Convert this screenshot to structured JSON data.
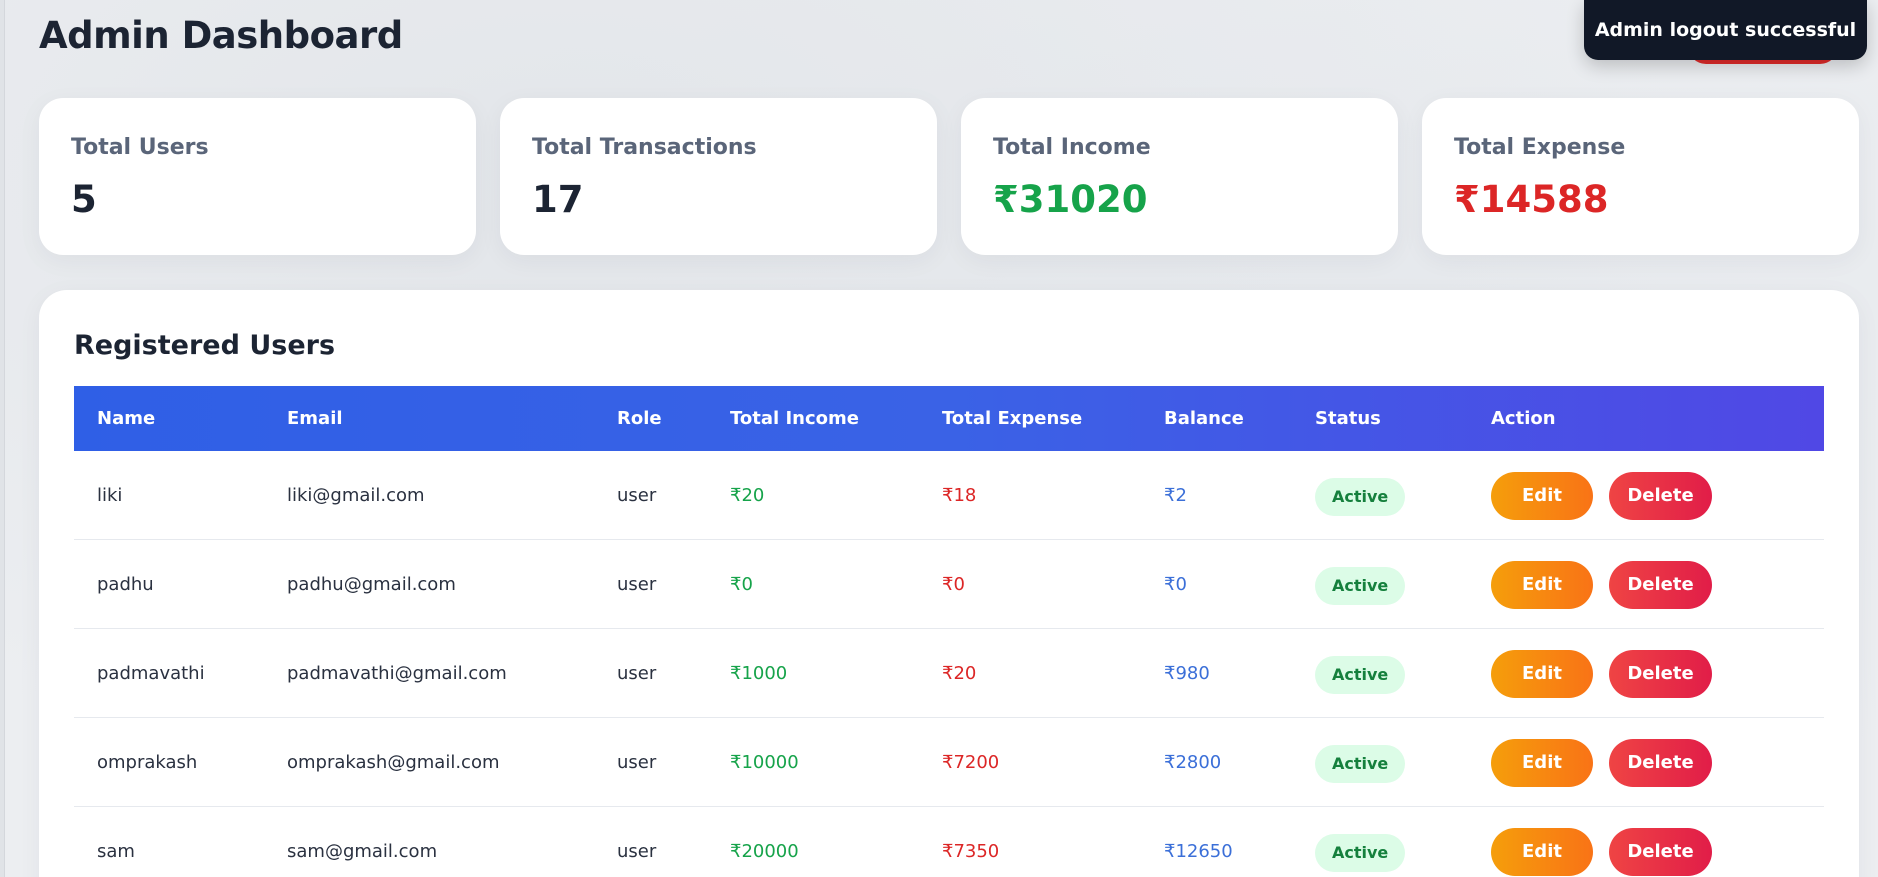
{
  "page": {
    "title": "Admin Dashboard"
  },
  "stats": [
    {
      "label": "Total Users",
      "value": "5"
    },
    {
      "label": "Total Transactions",
      "value": "17"
    },
    {
      "label": "Total Income",
      "value": "₹31020"
    },
    {
      "label": "Total Expense",
      "value": "₹14588"
    }
  ],
  "users_table": {
    "title": "Registered Users",
    "columns": [
      "Name",
      "Email",
      "Role",
      "Total Income",
      "Total Expense",
      "Balance",
      "Status",
      "Action"
    ],
    "rows": [
      {
        "name": "liki",
        "email": "liki@gmail.com",
        "role": "user",
        "income": "₹20",
        "expense": "₹18",
        "balance": "₹2",
        "status": "Active"
      },
      {
        "name": "padhu",
        "email": "padhu@gmail.com",
        "role": "user",
        "income": "₹0",
        "expense": "₹0",
        "balance": "₹0",
        "status": "Active"
      },
      {
        "name": "padmavathi",
        "email": "padmavathi@gmail.com",
        "role": "user",
        "income": "₹1000",
        "expense": "₹20",
        "balance": "₹980",
        "status": "Active"
      },
      {
        "name": "omprakash",
        "email": "omprakash@gmail.com",
        "role": "user",
        "income": "₹10000",
        "expense": "₹7200",
        "balance": "₹2800",
        "status": "Active"
      },
      {
        "name": "sam",
        "email": "sam@gmail.com",
        "role": "user",
        "income": "₹20000",
        "expense": "₹7350",
        "balance": "₹12650",
        "status": "Active"
      }
    ],
    "edit_label": "Edit",
    "delete_label": "Delete"
  },
  "toast": {
    "message": "Admin logout successful"
  },
  "colors": {
    "income": "#16a34a",
    "expense": "#dc2626",
    "balance": "#3b6fd8",
    "header_gradient_start": "#2f5fe6",
    "header_gradient_end": "#5048e5",
    "status_bg": "#dcfce7",
    "status_text": "#15803d",
    "edit_button": "#f59e0b",
    "delete_button": "#ef4444"
  }
}
